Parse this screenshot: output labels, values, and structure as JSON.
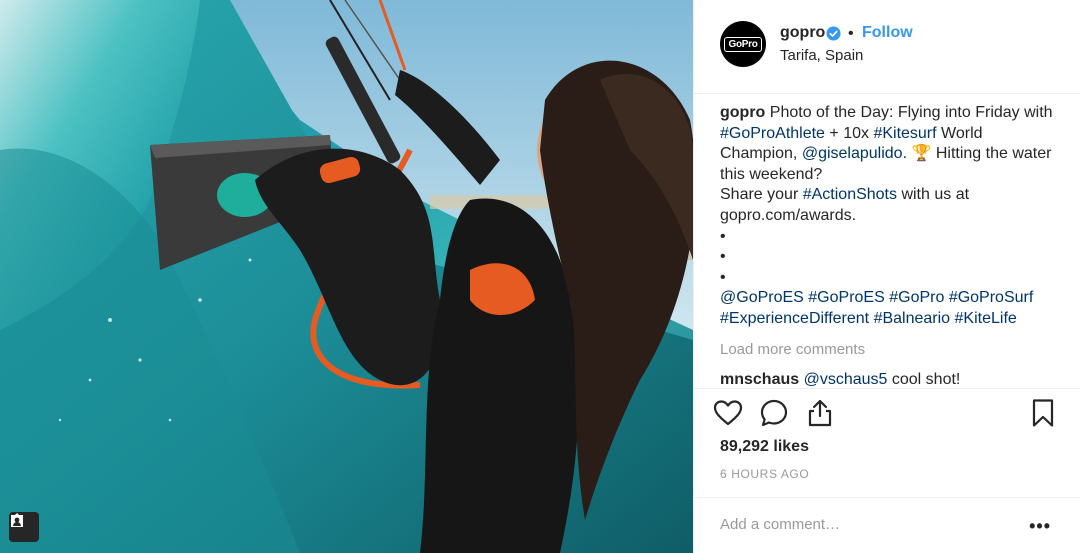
{
  "header": {
    "username": "gopro",
    "separator": "•",
    "follow_label": "Follow",
    "location": "Tarifa, Spain",
    "avatar_logo_text": "GoPro"
  },
  "caption": {
    "username": "gopro",
    "text1": " Photo of the Day: Flying into Friday with ",
    "tag1": "#GoProAthlete",
    "text2": " + 10x ",
    "tag2": "#Kitesurf",
    "text3": " World Champion, ",
    "mention": "@giselapulido",
    "text4": ". 🏆  Hitting the water this weekend?",
    "line2_text": "Share your ",
    "tag3": "#ActionShots",
    "line2_text2": " with us at gopro.com/awards.",
    "bullets": [
      "•",
      "•",
      "•"
    ],
    "hashtags_line1": [
      "@GoProES",
      "#GoProES",
      "#GoPro",
      "#GoProSurf"
    ],
    "hashtags_line2": [
      "#ExperienceDifferent",
      "#Balneario",
      "#KiteLife"
    ]
  },
  "load_more": "Load more comments",
  "comment": {
    "username": "mnschaus",
    "mention": "@vschaus5",
    "text": " cool shot!"
  },
  "icons": {
    "like": "heart-icon",
    "comment": "comment-icon",
    "share": "share-icon",
    "save": "bookmark-icon",
    "verified": "verified-badge-icon",
    "tagged_user": "user-tag-icon",
    "more": "more-options-icon"
  },
  "likes": "89,292 likes",
  "timestamp": "6 HOURS AGO",
  "add_comment": {
    "placeholder": "Add a comment…",
    "more_label": "•••"
  },
  "colors": {
    "link_blue": "#3897f0",
    "hashtag": "#003569",
    "muted": "#999999",
    "text": "#262626",
    "border": "#efefef"
  }
}
